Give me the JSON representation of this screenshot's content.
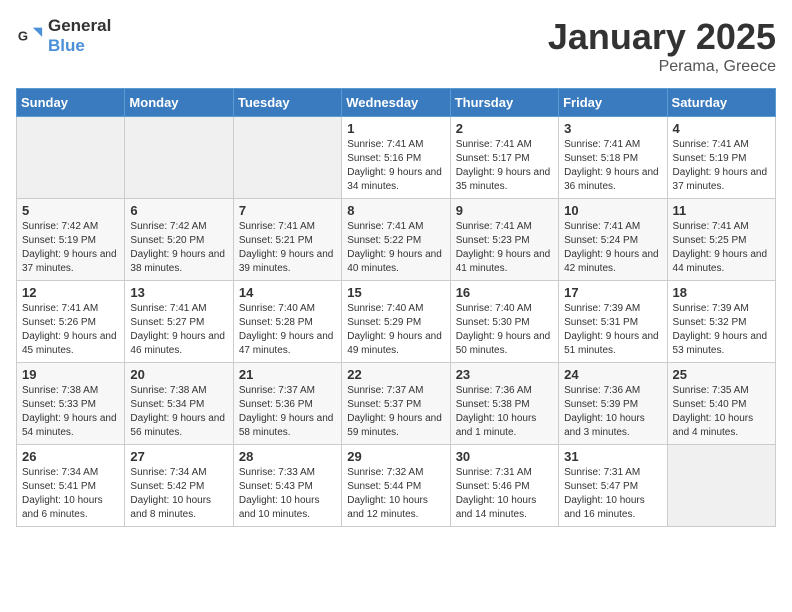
{
  "header": {
    "logo_general": "General",
    "logo_blue": "Blue",
    "month_title": "January 2025",
    "location": "Perama, Greece"
  },
  "days_of_week": [
    "Sunday",
    "Monday",
    "Tuesday",
    "Wednesday",
    "Thursday",
    "Friday",
    "Saturday"
  ],
  "weeks": [
    [
      {
        "day": "",
        "empty": true
      },
      {
        "day": "",
        "empty": true
      },
      {
        "day": "",
        "empty": true
      },
      {
        "day": "1",
        "sunrise": "Sunrise: 7:41 AM",
        "sunset": "Sunset: 5:16 PM",
        "daylight": "Daylight: 9 hours and 34 minutes."
      },
      {
        "day": "2",
        "sunrise": "Sunrise: 7:41 AM",
        "sunset": "Sunset: 5:17 PM",
        "daylight": "Daylight: 9 hours and 35 minutes."
      },
      {
        "day": "3",
        "sunrise": "Sunrise: 7:41 AM",
        "sunset": "Sunset: 5:18 PM",
        "daylight": "Daylight: 9 hours and 36 minutes."
      },
      {
        "day": "4",
        "sunrise": "Sunrise: 7:41 AM",
        "sunset": "Sunset: 5:19 PM",
        "daylight": "Daylight: 9 hours and 37 minutes."
      }
    ],
    [
      {
        "day": "5",
        "sunrise": "Sunrise: 7:42 AM",
        "sunset": "Sunset: 5:19 PM",
        "daylight": "Daylight: 9 hours and 37 minutes."
      },
      {
        "day": "6",
        "sunrise": "Sunrise: 7:42 AM",
        "sunset": "Sunset: 5:20 PM",
        "daylight": "Daylight: 9 hours and 38 minutes."
      },
      {
        "day": "7",
        "sunrise": "Sunrise: 7:41 AM",
        "sunset": "Sunset: 5:21 PM",
        "daylight": "Daylight: 9 hours and 39 minutes."
      },
      {
        "day": "8",
        "sunrise": "Sunrise: 7:41 AM",
        "sunset": "Sunset: 5:22 PM",
        "daylight": "Daylight: 9 hours and 40 minutes."
      },
      {
        "day": "9",
        "sunrise": "Sunrise: 7:41 AM",
        "sunset": "Sunset: 5:23 PM",
        "daylight": "Daylight: 9 hours and 41 minutes."
      },
      {
        "day": "10",
        "sunrise": "Sunrise: 7:41 AM",
        "sunset": "Sunset: 5:24 PM",
        "daylight": "Daylight: 9 hours and 42 minutes."
      },
      {
        "day": "11",
        "sunrise": "Sunrise: 7:41 AM",
        "sunset": "Sunset: 5:25 PM",
        "daylight": "Daylight: 9 hours and 44 minutes."
      }
    ],
    [
      {
        "day": "12",
        "sunrise": "Sunrise: 7:41 AM",
        "sunset": "Sunset: 5:26 PM",
        "daylight": "Daylight: 9 hours and 45 minutes."
      },
      {
        "day": "13",
        "sunrise": "Sunrise: 7:41 AM",
        "sunset": "Sunset: 5:27 PM",
        "daylight": "Daylight: 9 hours and 46 minutes."
      },
      {
        "day": "14",
        "sunrise": "Sunrise: 7:40 AM",
        "sunset": "Sunset: 5:28 PM",
        "daylight": "Daylight: 9 hours and 47 minutes."
      },
      {
        "day": "15",
        "sunrise": "Sunrise: 7:40 AM",
        "sunset": "Sunset: 5:29 PM",
        "daylight": "Daylight: 9 hours and 49 minutes."
      },
      {
        "day": "16",
        "sunrise": "Sunrise: 7:40 AM",
        "sunset": "Sunset: 5:30 PM",
        "daylight": "Daylight: 9 hours and 50 minutes."
      },
      {
        "day": "17",
        "sunrise": "Sunrise: 7:39 AM",
        "sunset": "Sunset: 5:31 PM",
        "daylight": "Daylight: 9 hours and 51 minutes."
      },
      {
        "day": "18",
        "sunrise": "Sunrise: 7:39 AM",
        "sunset": "Sunset: 5:32 PM",
        "daylight": "Daylight: 9 hours and 53 minutes."
      }
    ],
    [
      {
        "day": "19",
        "sunrise": "Sunrise: 7:38 AM",
        "sunset": "Sunset: 5:33 PM",
        "daylight": "Daylight: 9 hours and 54 minutes."
      },
      {
        "day": "20",
        "sunrise": "Sunrise: 7:38 AM",
        "sunset": "Sunset: 5:34 PM",
        "daylight": "Daylight: 9 hours and 56 minutes."
      },
      {
        "day": "21",
        "sunrise": "Sunrise: 7:37 AM",
        "sunset": "Sunset: 5:36 PM",
        "daylight": "Daylight: 9 hours and 58 minutes."
      },
      {
        "day": "22",
        "sunrise": "Sunrise: 7:37 AM",
        "sunset": "Sunset: 5:37 PM",
        "daylight": "Daylight: 9 hours and 59 minutes."
      },
      {
        "day": "23",
        "sunrise": "Sunrise: 7:36 AM",
        "sunset": "Sunset: 5:38 PM",
        "daylight": "Daylight: 10 hours and 1 minute."
      },
      {
        "day": "24",
        "sunrise": "Sunrise: 7:36 AM",
        "sunset": "Sunset: 5:39 PM",
        "daylight": "Daylight: 10 hours and 3 minutes."
      },
      {
        "day": "25",
        "sunrise": "Sunrise: 7:35 AM",
        "sunset": "Sunset: 5:40 PM",
        "daylight": "Daylight: 10 hours and 4 minutes."
      }
    ],
    [
      {
        "day": "26",
        "sunrise": "Sunrise: 7:34 AM",
        "sunset": "Sunset: 5:41 PM",
        "daylight": "Daylight: 10 hours and 6 minutes."
      },
      {
        "day": "27",
        "sunrise": "Sunrise: 7:34 AM",
        "sunset": "Sunset: 5:42 PM",
        "daylight": "Daylight: 10 hours and 8 minutes."
      },
      {
        "day": "28",
        "sunrise": "Sunrise: 7:33 AM",
        "sunset": "Sunset: 5:43 PM",
        "daylight": "Daylight: 10 hours and 10 minutes."
      },
      {
        "day": "29",
        "sunrise": "Sunrise: 7:32 AM",
        "sunset": "Sunset: 5:44 PM",
        "daylight": "Daylight: 10 hours and 12 minutes."
      },
      {
        "day": "30",
        "sunrise": "Sunrise: 7:31 AM",
        "sunset": "Sunset: 5:46 PM",
        "daylight": "Daylight: 10 hours and 14 minutes."
      },
      {
        "day": "31",
        "sunrise": "Sunrise: 7:31 AM",
        "sunset": "Sunset: 5:47 PM",
        "daylight": "Daylight: 10 hours and 16 minutes."
      },
      {
        "day": "",
        "empty": true
      }
    ]
  ]
}
